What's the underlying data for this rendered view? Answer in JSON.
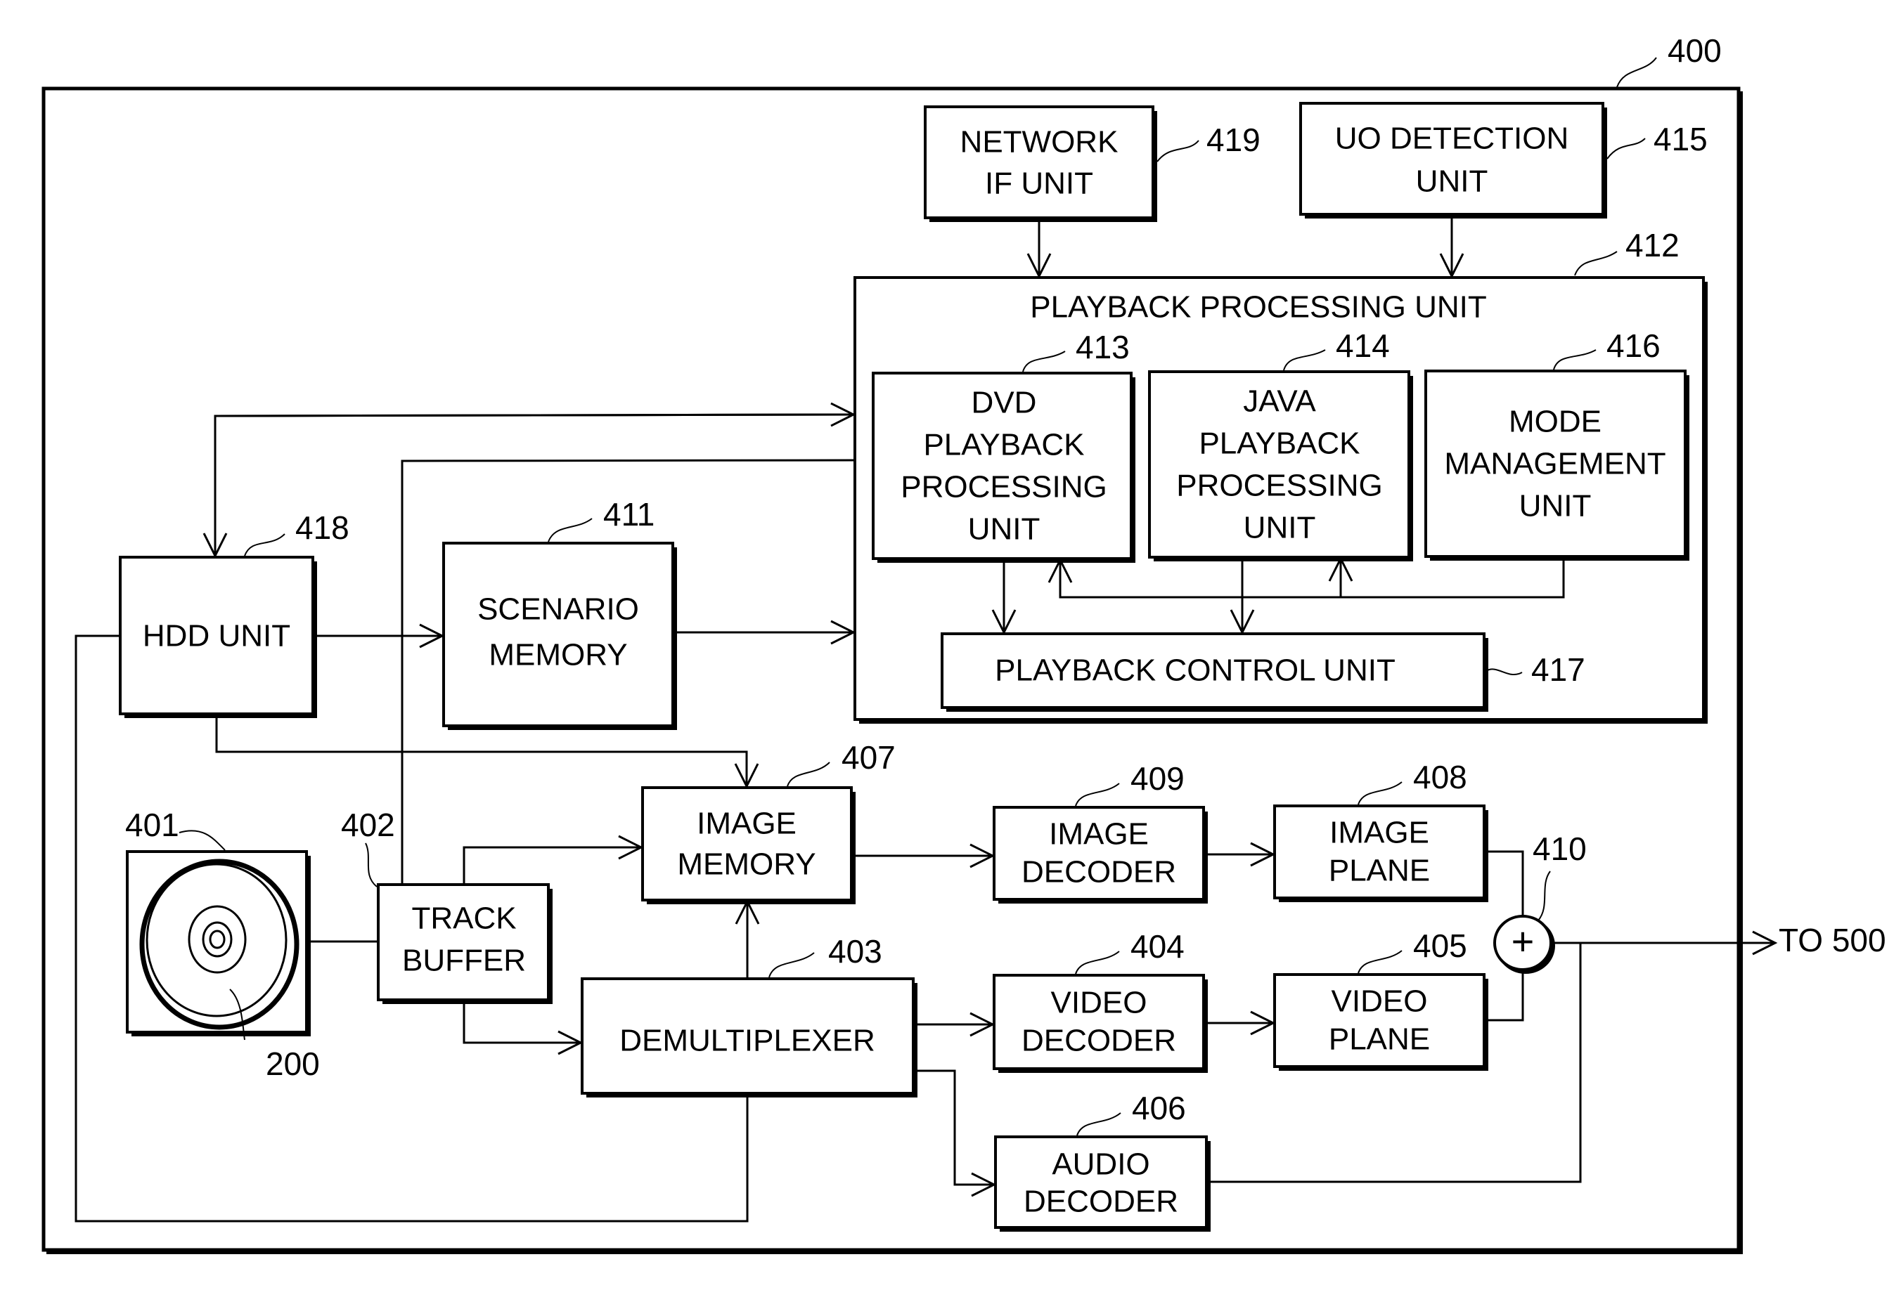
{
  "figure": {
    "device_ref": "400",
    "output_label": "TO 500",
    "blocks": {
      "network_if": {
        "lines": [
          "NETWORK",
          "IF UNIT"
        ],
        "ref": "419"
      },
      "uo_detection": {
        "lines": [
          "UO DETECTION",
          "UNIT"
        ],
        "ref": "415"
      },
      "playback_processing": {
        "title": "PLAYBACK PROCESSING UNIT",
        "ref": "412"
      },
      "dvd_playback": {
        "lines": [
          "DVD",
          "PLAYBACK",
          "PROCESSING",
          "UNIT"
        ],
        "ref": "413"
      },
      "java_playback": {
        "lines": [
          "JAVA",
          "PLAYBACK",
          "PROCESSING",
          "UNIT"
        ],
        "ref": "414"
      },
      "mode_management": {
        "lines": [
          "MODE",
          "MANAGEMENT",
          "UNIT"
        ],
        "ref": "416"
      },
      "playback_control": {
        "lines": [
          "PLAYBACK CONTROL UNIT"
        ],
        "ref": "417"
      },
      "hdd": {
        "lines": [
          "HDD UNIT"
        ],
        "ref": "418"
      },
      "scenario_memory": {
        "lines": [
          "SCENARIO",
          "MEMORY"
        ],
        "ref": "411"
      },
      "image_memory": {
        "lines": [
          "IMAGE",
          "MEMORY"
        ],
        "ref": "407"
      },
      "disc_drive": {
        "ref": "401",
        "disc_ref": "200"
      },
      "track_buffer": {
        "lines": [
          "TRACK",
          "BUFFER"
        ],
        "ref": "402"
      },
      "demultiplexer": {
        "lines": [
          "DEMULTIPLEXER"
        ],
        "ref": "403"
      },
      "image_decoder": {
        "lines": [
          "IMAGE",
          "DECODER"
        ],
        "ref": "409"
      },
      "image_plane": {
        "lines": [
          "IMAGE",
          "PLANE"
        ],
        "ref": "408"
      },
      "video_decoder": {
        "lines": [
          "VIDEO",
          "DECODER"
        ],
        "ref": "404"
      },
      "video_plane": {
        "lines": [
          "VIDEO",
          "PLANE"
        ],
        "ref": "405"
      },
      "audio_decoder": {
        "lines": [
          "AUDIO",
          "DECODER"
        ],
        "ref": "406"
      },
      "adder": {
        "symbol": "+",
        "ref": "410"
      }
    }
  }
}
